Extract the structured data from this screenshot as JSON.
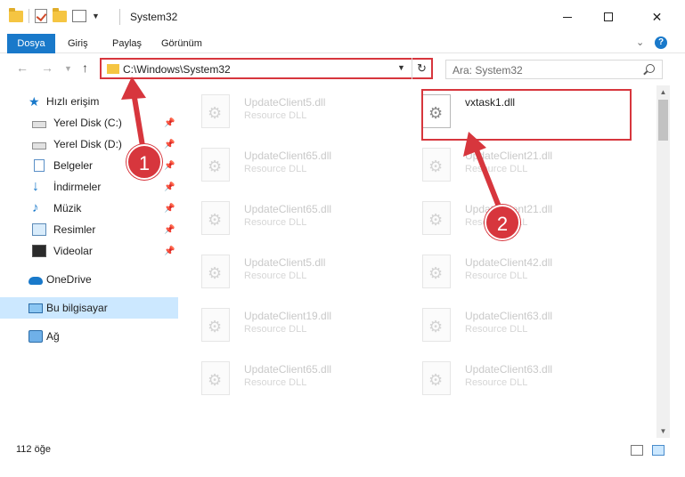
{
  "window": {
    "title": "System32"
  },
  "ribbon": {
    "tabs": [
      "Dosya",
      "Giriş",
      "Paylaş",
      "Görünüm"
    ],
    "help": "?"
  },
  "address": {
    "path": "C:\\Windows\\System32",
    "search_placeholder": "Ara: System32"
  },
  "sidebar": {
    "quick_access": "Hızlı erişim",
    "items": [
      "Yerel Disk (C:)",
      "Yerel Disk (D:)",
      "Belgeler",
      "İndirmeler",
      "Müzik",
      "Resimler",
      "Videolar"
    ],
    "onedrive": "OneDrive",
    "this_pc": "Bu bilgisayar",
    "network": "Ağ"
  },
  "files": {
    "main": {
      "name": "vxtask1.dll"
    },
    "type_label": "Resource DLL",
    "left_column": [
      "UpdateClient5.dll",
      "UpdateClient65.dll",
      "UpdateClient65.dll",
      "UpdateClient5.dll",
      "UpdateClient19.dll",
      "UpdateClient65.dll"
    ],
    "right_column": [
      "UpdateClient21.dll",
      "UpdateClient21.dll",
      "UpdateClient42.dll",
      "UpdateClient63.dll",
      "UpdateClient63.dll"
    ]
  },
  "status": {
    "count": "112 öğe"
  },
  "annotations": {
    "step1": "1",
    "step2": "2",
    "color": "#d7363d"
  },
  "colors": {
    "accent": "#1979ca",
    "selection": "#cce8ff",
    "highlight": "#d7363d"
  }
}
